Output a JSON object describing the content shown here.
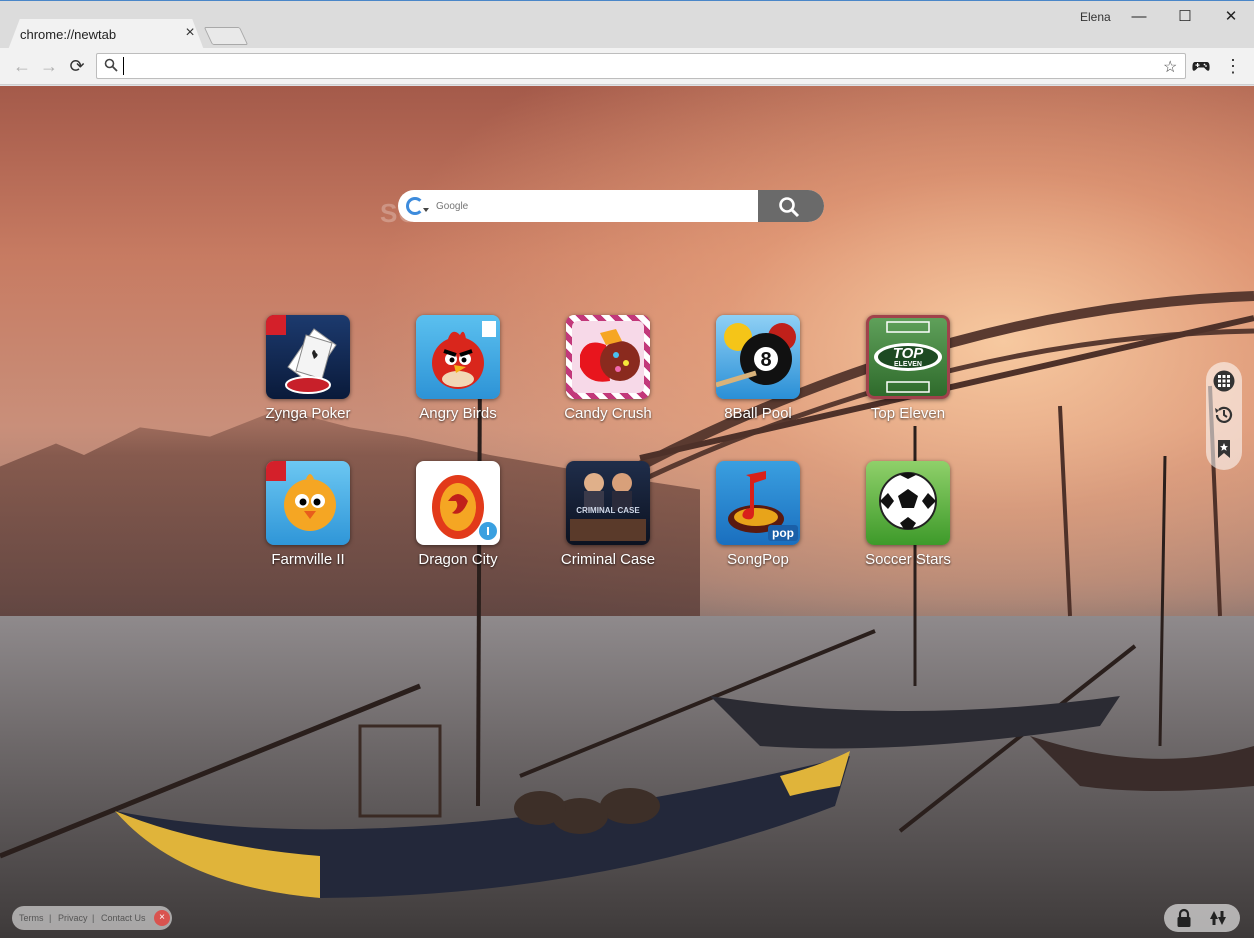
{
  "browser": {
    "profile_name": "Elena",
    "tab": {
      "title": "chrome://newtab",
      "close": "×"
    },
    "window_controls": {
      "minimize": "—",
      "maximize": "☐",
      "close": "✕"
    },
    "omnibox": {
      "value": "",
      "placeholder": ""
    },
    "nav": {
      "back": "←",
      "forward": "→",
      "reload": "⟳"
    },
    "bookmark_star": "☆",
    "menu": "⋮"
  },
  "newtab": {
    "watermark": "SOFTPEDIA",
    "search": {
      "engine": "Google",
      "placeholder": "Google"
    },
    "apps": [
      {
        "label": "Zynga Poker",
        "icon": "zynga-poker-icon"
      },
      {
        "label": "Angry Birds",
        "icon": "angry-birds-icon"
      },
      {
        "label": "Candy Crush",
        "icon": "candy-crush-icon"
      },
      {
        "label": "8Ball Pool",
        "icon": "8ball-pool-icon"
      },
      {
        "label": "Top Eleven",
        "icon": "top-eleven-icon"
      },
      {
        "label": "Farmville II",
        "icon": "farmville-icon"
      },
      {
        "label": "Dragon City",
        "icon": "dragon-city-icon"
      },
      {
        "label": "Criminal Case",
        "icon": "criminal-case-icon"
      },
      {
        "label": "SongPop",
        "icon": "songpop-icon"
      },
      {
        "label": "Soccer Stars",
        "icon": "soccer-stars-icon"
      }
    ],
    "icon_text": {
      "top_eleven": "TOP",
      "top_eleven_sub": "ELEVEN",
      "songpop": "pop",
      "criminal_case": "CRIMINAL CASE",
      "eight_ball": "8"
    },
    "side_dock": [
      "apps-grid-icon",
      "history-icon",
      "bookmarks-icon"
    ],
    "footer": {
      "terms": "Terms",
      "privacy": "Privacy",
      "contact": "Contact Us",
      "separator": "|",
      "close": "×"
    },
    "footer_tools": [
      "lock-icon",
      "sync-icon"
    ]
  }
}
